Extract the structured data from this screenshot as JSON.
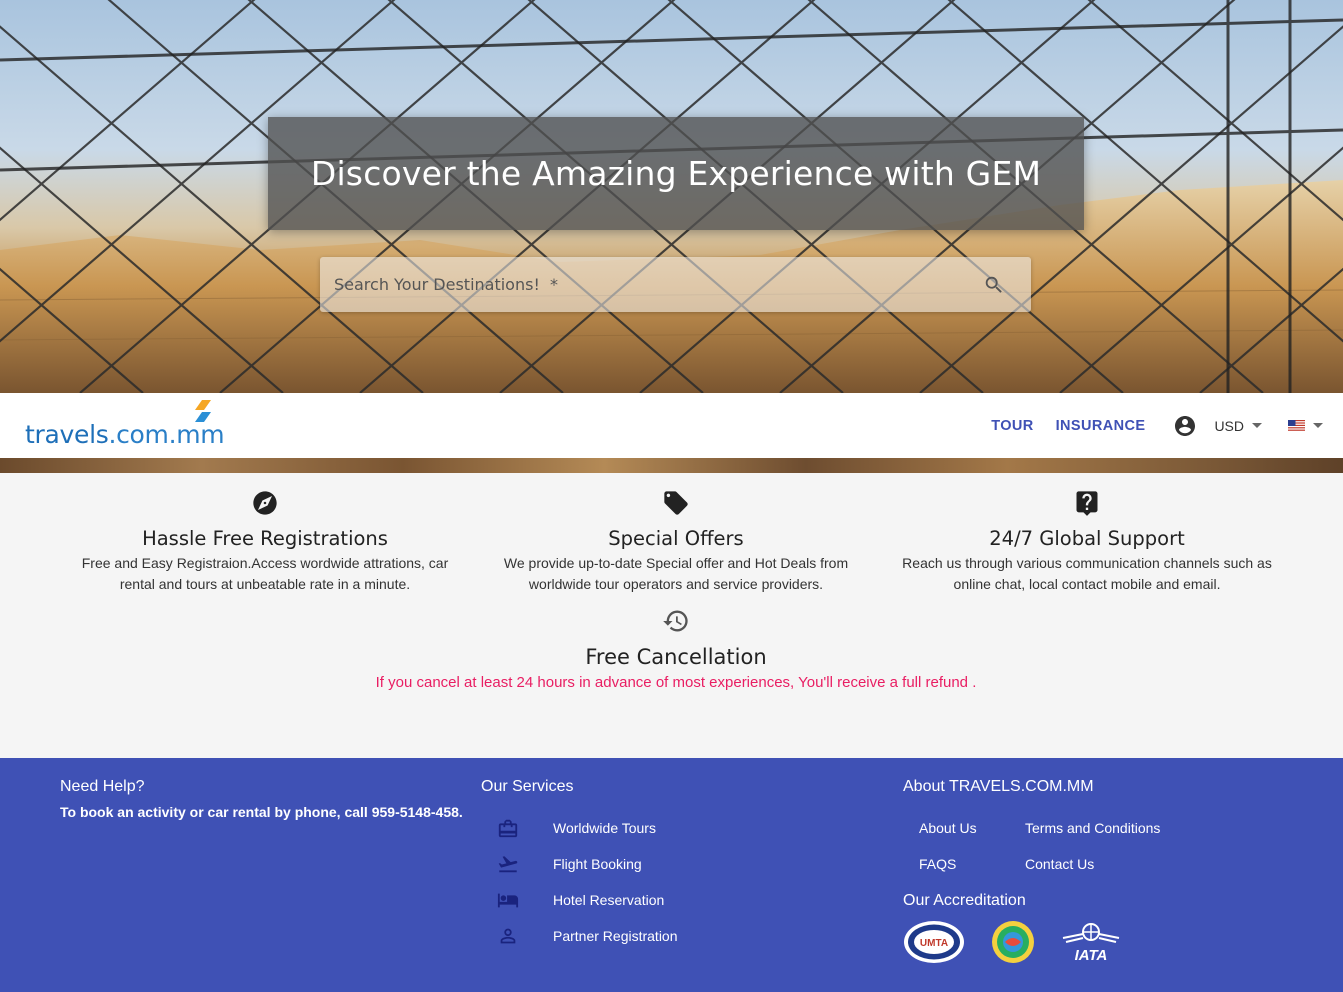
{
  "hero": {
    "title": "Discover the Amazing Experience with GEM",
    "search_placeholder": "Search Your Destinations!  *"
  },
  "navbar": {
    "logo_text_a": "travels",
    "logo_text_b": ".com.mm",
    "links": [
      "TOUR",
      "INSURANCE"
    ],
    "currency": "USD"
  },
  "features": [
    {
      "icon": "compass-icon",
      "title": "Hassle Free Registrations",
      "desc_line1": "Free and Easy Registraion.Access wordwide attrations, car",
      "desc_line2": "rental and tours at unbeatable rate in a minute."
    },
    {
      "icon": "tag-icon",
      "title": "Special Offers",
      "desc_line1": "We provide up-to-date Special offer and Hot Deals from",
      "desc_line2": "worldwide tour operators and service providers."
    },
    {
      "icon": "live-help-icon",
      "title": "24/7 Global Support",
      "desc_line1": "Reach us through various communication channels such as",
      "desc_line2": "online chat, local contact mobile and email."
    }
  ],
  "cancellation": {
    "icon": "history-icon",
    "title": "Free Cancellation",
    "desc": "If you cancel at least 24 hours in advance of most experiences, You'll receive a full refund ."
  },
  "footer": {
    "help": {
      "heading": "Need Help?",
      "text": "To book an activity or car rental by phone, call 959-5148-458."
    },
    "services": {
      "heading": "Our Services",
      "items": [
        {
          "icon": "briefcase-icon",
          "label": "Worldwide Tours"
        },
        {
          "icon": "flight-takeoff-icon",
          "label": "Flight Booking"
        },
        {
          "icon": "hotel-bed-icon",
          "label": "Hotel Reservation"
        },
        {
          "icon": "person-icon",
          "label": "Partner Registration"
        }
      ]
    },
    "about": {
      "heading": "About TRAVELS.COM.MM",
      "links": [
        "About Us",
        "Terms and Conditions",
        "FAQS",
        "Contact Us"
      ],
      "accreditation_heading": "Our Accreditation",
      "badges": [
        "UMTA",
        "",
        "IATA"
      ]
    }
  },
  "colors": {
    "primary": "#3f51b5",
    "accent_pink": "#e91e63",
    "logo_blue": "#1e6fb8"
  }
}
